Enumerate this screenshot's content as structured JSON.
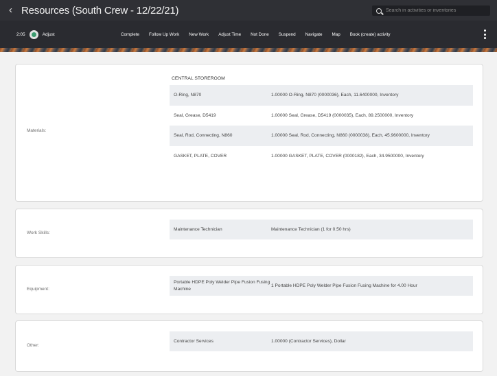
{
  "header": {
    "back_icon": "chevron-left-icon",
    "title": "Resources (South Crew - 12/22/21)",
    "search_placeholder": "Search in activities or inventories"
  },
  "toolbar": {
    "time": "2:05",
    "adjust_label": "Adjust",
    "actions": [
      "Complete",
      "Follow Up Work",
      "New Work",
      "Adjust Time",
      "Not Done",
      "Suspend",
      "Navigate",
      "Map",
      "Book (create) activity"
    ]
  },
  "materials": {
    "label": "Materials:",
    "section": "CENTRAL STOREROOM",
    "rows": [
      {
        "name": "O-Ring, N870",
        "detail": "1.00000 O-Ring, N870 (0000036), Each, 11.6400000, Inventory"
      },
      {
        "name": "Seal, Grease, D5419",
        "detail": "1.00000 Seal, Grease, D5419 (0000035), Each, 89.2500000, Inventory"
      },
      {
        "name": "Seal, Rod, Connecting, N860",
        "detail": "1.00000 Seal, Rod, Connecting, N860 (0000038), Each, 45.9600000, Inventory"
      },
      {
        "name": "GASKET, PLATE, COVER",
        "detail": "1.00000 GASKET, PLATE, COVER (0000182), Each, 34.9500000, Inventory"
      }
    ]
  },
  "work_skills": {
    "label": "Work Skills:",
    "rows": [
      {
        "name": "Maintenance Technician",
        "detail": "Maintenance Technician (1 for 0.50 hrs)"
      }
    ]
  },
  "equipment": {
    "label": "Equipment:",
    "rows": [
      {
        "name": "Portable HDPE Poly Welder Pipe Fusion Fusing Machine",
        "detail": "1 Portable HDPE Poly Welder Pipe Fusion Fusing Machine for 4.00 Hour"
      }
    ]
  },
  "other": {
    "label": "Other:",
    "rows": [
      {
        "name": "Contractor Services",
        "detail": "1.00000 (Contractor Services), Dollar"
      }
    ]
  }
}
